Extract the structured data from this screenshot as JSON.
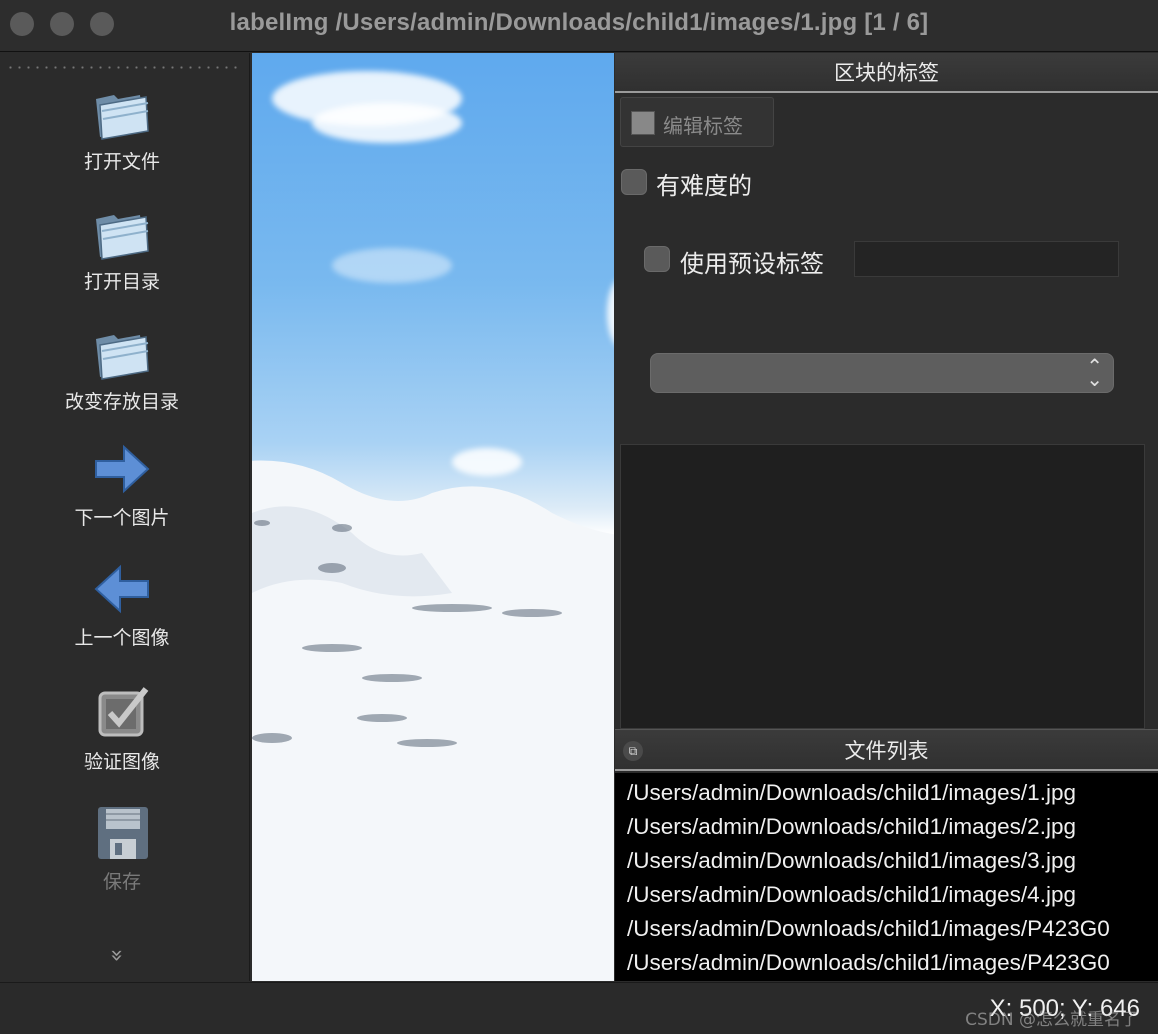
{
  "window": {
    "title": "labelImg /Users/admin/Downloads/child1/images/1.jpg [1 / 6]"
  },
  "toolbar": {
    "items": [
      {
        "label": "打开文件",
        "icon": "folder-icon",
        "enabled": true
      },
      {
        "label": "打开目录",
        "icon": "folder-icon",
        "enabled": true
      },
      {
        "label": "改变存放目录",
        "icon": "folder-icon",
        "enabled": true
      },
      {
        "label": "下一个图片",
        "icon": "arrow-right-icon",
        "enabled": true
      },
      {
        "label": "上一个图像",
        "icon": "arrow-left-icon",
        "enabled": true
      },
      {
        "label": "验证图像",
        "icon": "checkbox-icon",
        "enabled": true
      },
      {
        "label": "保存",
        "icon": "floppy-disk-icon",
        "enabled": false
      }
    ],
    "more_glyph": "»"
  },
  "label_panel": {
    "title": "区块的标签",
    "edit_button": "编辑标签",
    "difficult_label": "有难度的",
    "difficult_checked": false,
    "use_default_label": "使用预设标签",
    "use_default_checked": false,
    "default_label_value": "",
    "combo_value": ""
  },
  "file_panel": {
    "title": "文件列表",
    "files": [
      "/Users/admin/Downloads/child1/images/1.jpg",
      "/Users/admin/Downloads/child1/images/2.jpg",
      "/Users/admin/Downloads/child1/images/3.jpg",
      "/Users/admin/Downloads/child1/images/4.jpg",
      "/Users/admin/Downloads/child1/images/P423G0",
      "/Users/admin/Downloads/child1/images/P423G0"
    ]
  },
  "status": {
    "coords": "X: 500; Y: 646",
    "watermark": "CSDN @怎么就重名了"
  },
  "colors": {
    "background": "#2b2b2b",
    "list_bg": "#000000",
    "sky": "#5fa9ee"
  }
}
